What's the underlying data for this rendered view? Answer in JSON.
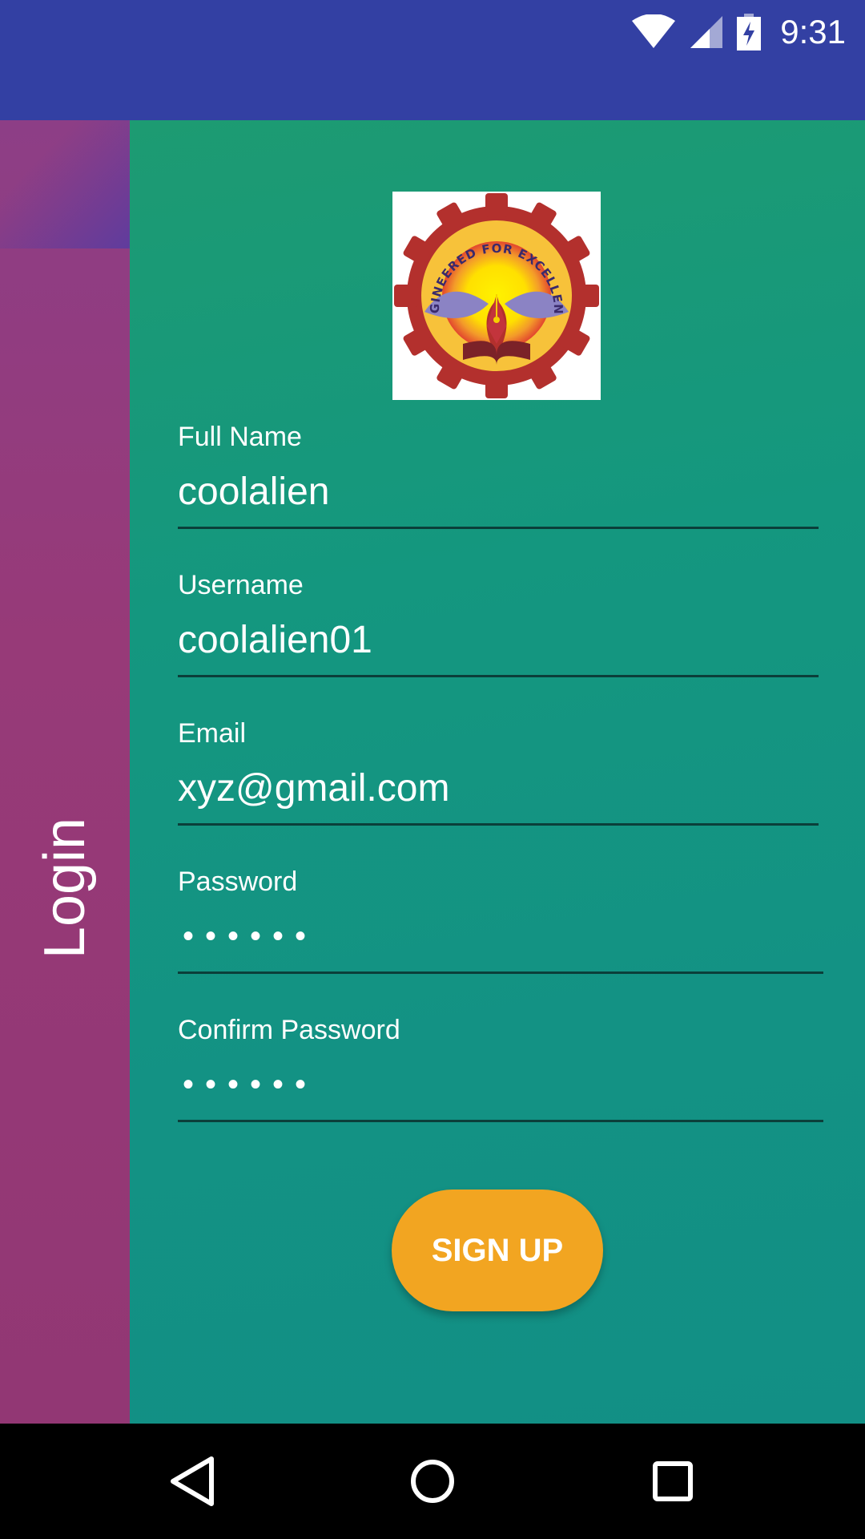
{
  "status_bar": {
    "time": "9:31"
  },
  "side_panel": {
    "label": "Login"
  },
  "logo": {
    "text": "ENGINEERED FOR EXCELLENCE"
  },
  "form": {
    "fields": [
      {
        "label": "Full Name",
        "value": "coolalien"
      },
      {
        "label": "Username",
        "value": "coolalien01"
      },
      {
        "label": "Email",
        "value": "xyz@gmail.com"
      },
      {
        "label": "Password",
        "value": "••••••"
      },
      {
        "label": "Confirm Password",
        "value": "••••••"
      }
    ],
    "submit_label": "SIGN UP"
  },
  "colors": {
    "status_bar": "#3340a3",
    "side_panel": "#973a78",
    "form_panel": "#14977f",
    "button": "#f2a521"
  },
  "icons": [
    "wifi-icon",
    "signal-icon",
    "battery-icon",
    "back-icon",
    "home-icon",
    "recents-icon"
  ]
}
